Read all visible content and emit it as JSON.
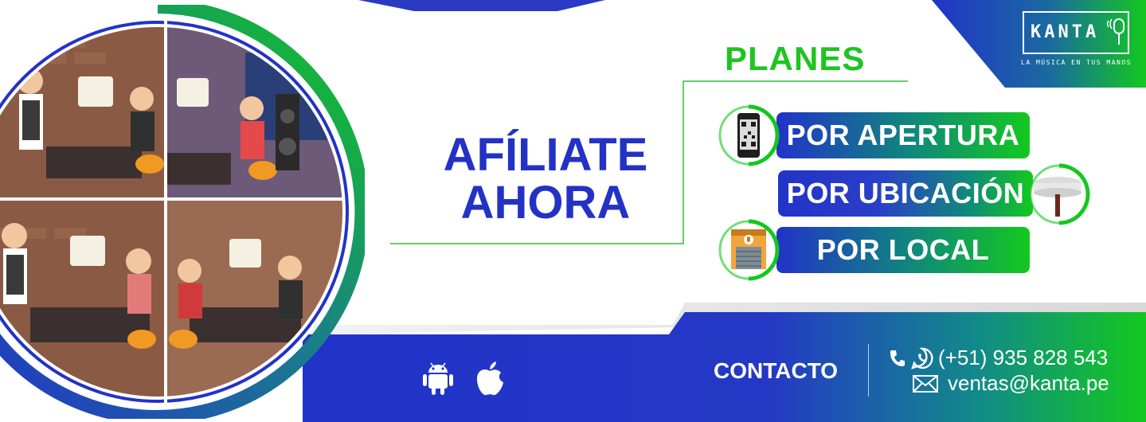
{
  "brand": {
    "name": "KANTA",
    "tagline": "LA MÚSICA EN TUS MANOS"
  },
  "headline": {
    "line1": "AFÍLIATE",
    "line2": "AHORA"
  },
  "plans": {
    "title": "PLANES",
    "items": [
      {
        "label": "POR APERTURA",
        "icon": "qr-phone-icon"
      },
      {
        "label": "POR UBICACIÓN",
        "icon": "table-icon"
      },
      {
        "label": "POR LOCAL",
        "icon": "storefront-icon"
      }
    ]
  },
  "footer": {
    "stores": [
      "android-icon",
      "apple-icon"
    ],
    "contact_label": "CONTACTO",
    "phone": "(+51) 935 828 543",
    "email": "ventas@kanta.pe"
  },
  "colors": {
    "blue": "#2332c5",
    "green": "#1fc41f",
    "teal": "#108a7a",
    "white": "#ffffff"
  }
}
